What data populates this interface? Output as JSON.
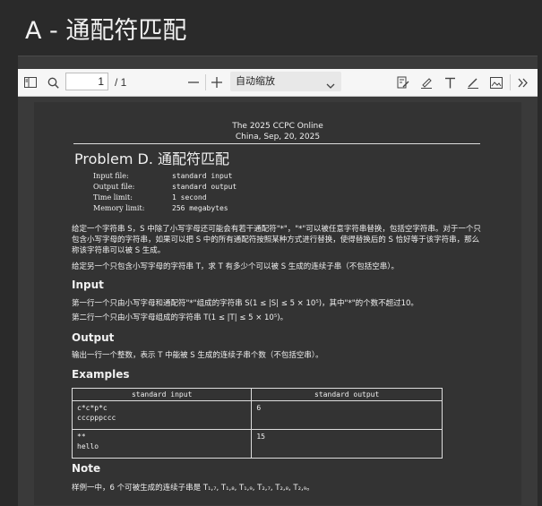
{
  "page": {
    "title": "A - 通配符匹配"
  },
  "toolbar": {
    "sidebar_icon": "sidebar-toggle-icon",
    "search_icon": "search-icon",
    "page_number": "1",
    "page_total": "/ 1",
    "zoom_value": "自动缩放",
    "icons": [
      "zoom-out-icon",
      "zoom-in-icon",
      "edit-doc-icon",
      "highlight-icon",
      "text-icon",
      "draw-icon",
      "image-icon",
      "more-tools-icon"
    ]
  },
  "doc": {
    "header_line1": "The 2025 CCPC Online",
    "header_line2": "China, Sep, 20, 2025",
    "problem_title": "Problem D. 通配符匹配",
    "meta": [
      {
        "label": "Input file:",
        "value": "standard input"
      },
      {
        "label": "Output file:",
        "value": "standard output"
      },
      {
        "label": "Time limit:",
        "value": "1 second"
      },
      {
        "label": "Memory limit:",
        "value": "256 megabytes"
      }
    ],
    "statement_p1": "给定一个字符串 S，S 中除了小写字母还可能会有若干通配符\"*\"，\"*\"可以被任意字符串替换，包括空字符串。对于一个只包含小写字母的字符串，如果可以把 S 中的所有通配符按照某种方式进行替换，使得替换后的 S 恰好等于该字符串，那么称该字符串可以被 S 生成。",
    "statement_p2": "给定另一个只包含小写字母的字符串 T，求 T 有多少个可以被 S 生成的连续子串（不包括空串）。",
    "input_heading": "Input",
    "input_p1": "第一行一个只由小写字母和通配符\"*\"组成的字符串 S(1 ≤ |S| ≤ 5 × 10⁵)，其中\"*\"的个数不超过10。",
    "input_p2": "第二行一个只由小写字母组成的字符串 T(1 ≤ |T| ≤ 5 × 10⁵)。",
    "output_heading": "Output",
    "output_p1": "输出一行一个整数，表示 T 中能被 S 生成的连续子串个数（不包括空串）。",
    "examples_heading": "Examples",
    "examples_table": {
      "headers": [
        "standard input",
        "standard output"
      ],
      "rows": [
        {
          "input": "c*c*p*c\ncccpppccc",
          "output": "6"
        },
        {
          "input": "**\nhello",
          "output": "15"
        }
      ]
    },
    "note_heading": "Note",
    "note_p1": "样例一中，6 个可被生成的连续子串是 T₁,₇, T₁,₈, T₁,₉, T₂,₇, T₂,₈, T₂,₉。"
  }
}
